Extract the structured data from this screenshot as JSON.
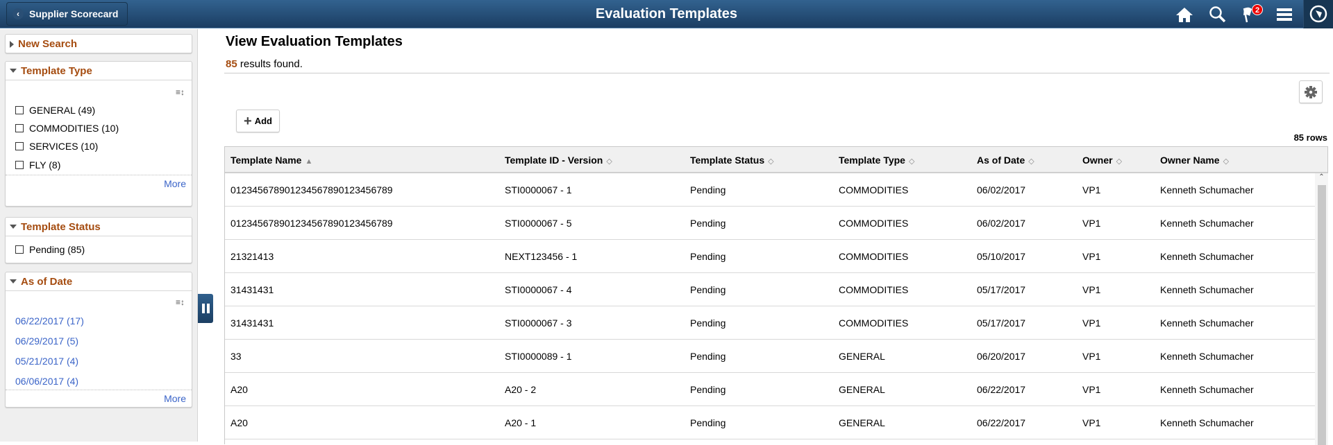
{
  "header": {
    "back_label": "Supplier Scorecard",
    "title": "Evaluation Templates",
    "notification_count": "2",
    "icons": [
      "home-icon",
      "search-icon",
      "notification-flag-icon",
      "menu-icon",
      "navbar-compass-icon"
    ]
  },
  "sidebar": {
    "new_search": "New Search",
    "template_type": {
      "title": "Template Type",
      "items": [
        "GENERAL (49)",
        "COMMODITIES (10)",
        "SERVICES (10)",
        "FLY (8)"
      ],
      "more": "More"
    },
    "template_status": {
      "title": "Template Status",
      "items": [
        "Pending (85)"
      ]
    },
    "as_of_date": {
      "title": "As of Date",
      "items": [
        "06/22/2017 (17)",
        "06/29/2017 (5)",
        "05/21/2017 (4)",
        "06/06/2017 (4)"
      ],
      "more": "More"
    }
  },
  "main": {
    "title": "View Evaluation Templates",
    "results_count": "85",
    "results_text": " results found.",
    "add_label": "Add",
    "rows_label": "85 rows",
    "columns": [
      "Template Name",
      "Template ID - Version",
      "Template Status",
      "Template Type",
      "As of Date",
      "Owner",
      "Owner Name"
    ],
    "rows": [
      [
        "012345678901234567890123456789",
        "STI0000067 - 1",
        "Pending",
        "COMMODITIES",
        "06/02/2017",
        "VP1",
        "Kenneth Schumacher"
      ],
      [
        "012345678901234567890123456789",
        "STI0000067 - 5",
        "Pending",
        "COMMODITIES",
        "06/02/2017",
        "VP1",
        "Kenneth Schumacher"
      ],
      [
        "21321413",
        "NEXT123456 - 1",
        "Pending",
        "COMMODITIES",
        "05/10/2017",
        "VP1",
        "Kenneth Schumacher"
      ],
      [
        "31431431",
        "STI0000067 - 4",
        "Pending",
        "COMMODITIES",
        "05/17/2017",
        "VP1",
        "Kenneth Schumacher"
      ],
      [
        "31431431",
        "STI0000067 - 3",
        "Pending",
        "COMMODITIES",
        "05/17/2017",
        "VP1",
        "Kenneth Schumacher"
      ],
      [
        "33",
        "STI0000089 - 1",
        "Pending",
        "GENERAL",
        "06/20/2017",
        "VP1",
        "Kenneth Schumacher"
      ],
      [
        "A20",
        "A20 - 2",
        "Pending",
        "GENERAL",
        "06/22/2017",
        "VP1",
        "Kenneth Schumacher"
      ],
      [
        "A20",
        "A20 - 1",
        "Pending",
        "GENERAL",
        "06/22/2017",
        "VP1",
        "Kenneth Schumacher"
      ]
    ]
  },
  "colors": {
    "header": "#1b3d62",
    "accent": "#a54c10",
    "link": "#3a64c8",
    "badge": "#e00000"
  }
}
